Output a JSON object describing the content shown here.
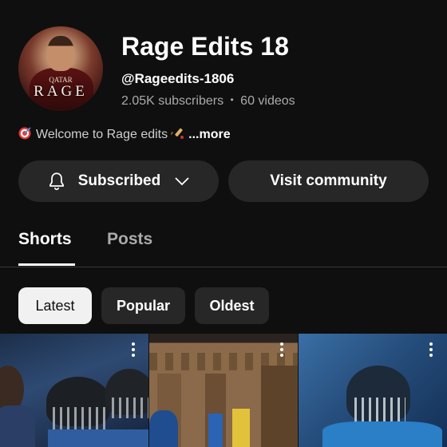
{
  "channel": {
    "avatar_sponsor_text": "QATAR",
    "avatar_brand_text": "RAGE",
    "name": "Rage Edits 18",
    "handle": "@Rageedits-1806",
    "subscribers": "2.05K subscribers",
    "separator": "•",
    "videos": "60 videos",
    "description": "Welcome to Rage edits",
    "more_label": "...more"
  },
  "actions": {
    "subscribed_label": "Subscribed",
    "community_label": "Visit community"
  },
  "tabs": [
    {
      "label": "Shorts",
      "active": true
    },
    {
      "label": "Posts",
      "active": false
    }
  ],
  "filters": [
    {
      "label": "Latest",
      "active": true
    },
    {
      "label": "Popular",
      "active": false
    },
    {
      "label": "Oldest",
      "active": false
    }
  ],
  "icons": {
    "description_lead": "target-icon",
    "description_trail": "cricket-bat-icon",
    "subscribe_bell": "bell-icon",
    "subscribe_menu": "chevron-down-icon",
    "thumbnail_menu": "kebab-menu-icon"
  },
  "colors": {
    "background": "#0f0f0f",
    "button_bg": "#272727",
    "active_chip_bg": "#f1f1f1",
    "secondary_text": "#aaaaaa"
  }
}
